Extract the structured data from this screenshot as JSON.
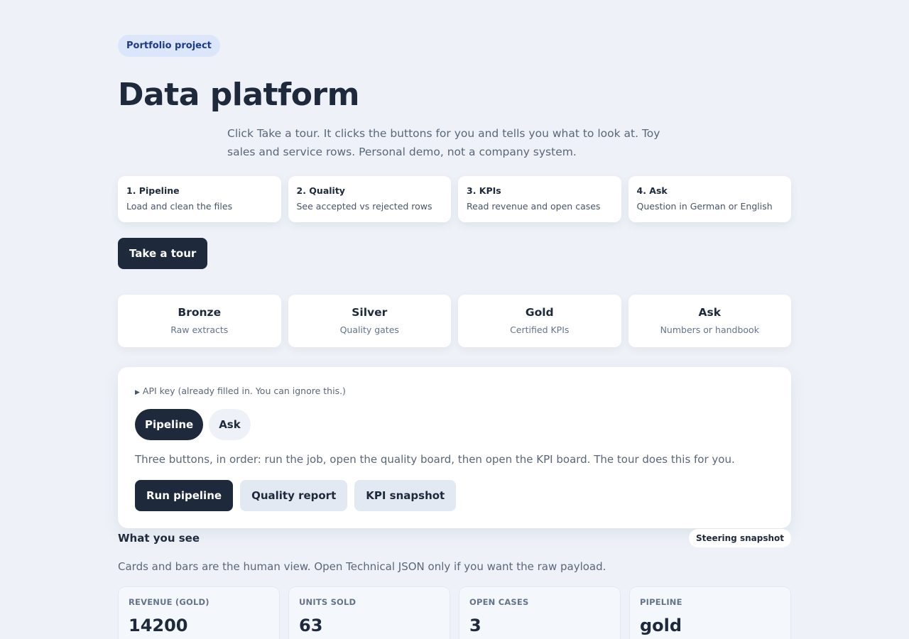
{
  "header": {
    "badge": "Portfolio project",
    "title": "Data platform",
    "intro": "Click Take a tour. It clicks the buttons for you and tells you what to look at. Toy sales and service rows. Personal demo, not a company system."
  },
  "steps": [
    {
      "title": "1. Pipeline",
      "desc": "Load and clean the files"
    },
    {
      "title": "2. Quality",
      "desc": "See accepted vs rejected rows"
    },
    {
      "title": "3. KPIs",
      "desc": "Read revenue and open cases"
    },
    {
      "title": "4. Ask",
      "desc": "Question in German or English"
    }
  ],
  "tour_button": "Take a tour",
  "layers": [
    {
      "title": "Bronze",
      "desc": "Raw extracts"
    },
    {
      "title": "Silver",
      "desc": "Quality gates"
    },
    {
      "title": "Gold",
      "desc": "Certified KPIs"
    },
    {
      "title": "Ask",
      "desc": "Numbers or handbook"
    }
  ],
  "panel": {
    "api_summary": "API key (already filled in. You can ignore this.)",
    "tabs": [
      "Pipeline",
      "Ask"
    ],
    "active_tab": "Pipeline",
    "description": "Three buttons, in order: run the job, open the quality board, then open the KPI board. The tour does this for you.",
    "actions": [
      "Run pipeline",
      "Quality report",
      "KPI snapshot"
    ]
  },
  "results": {
    "title": "What you see",
    "tag": "Steering snapshot",
    "desc": "Cards and bars are the human view. Open Technical JSON only if you want the raw payload.",
    "kpis": [
      {
        "label": "REVENUE (GOLD)",
        "value": "14200"
      },
      {
        "label": "UNITS SOLD",
        "value": "63"
      },
      {
        "label": "OPEN CASES",
        "value": "3"
      },
      {
        "label": "PIPELINE",
        "value": "gold"
      }
    ]
  },
  "colors": {
    "background": "#eef2f8",
    "primary": "#1e293b",
    "badge_bg": "#dbe6fb",
    "badge_text": "#1e3a8a"
  }
}
